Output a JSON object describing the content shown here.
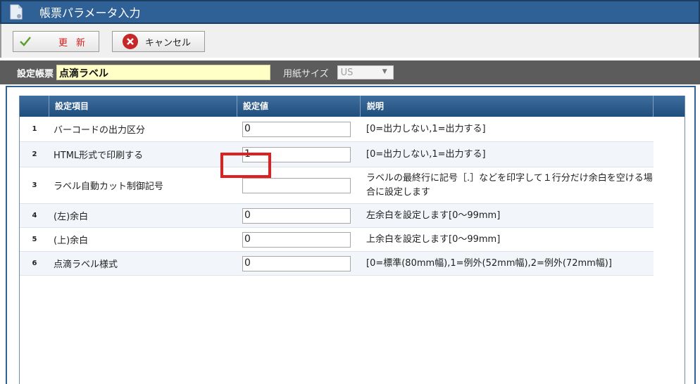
{
  "window": {
    "title": "帳票パラメータ入力"
  },
  "toolbar": {
    "update_label": "更新",
    "cancel_label": "キャンセル"
  },
  "filter": {
    "form_label": "設定帳票",
    "form_value": "点滴ラベル",
    "paper_label": "用紙サイズ",
    "paper_value": "US"
  },
  "table": {
    "headers": {
      "item": "設定項目",
      "value": "設定値",
      "desc": "説明"
    },
    "rows": [
      {
        "num": "1",
        "item": "バーコードの出力区分",
        "value": "0",
        "desc": "[0=出力しない,1=出力する]"
      },
      {
        "num": "2",
        "item": "HTML形式で印刷する",
        "value": "1",
        "desc": "[0=出力しない,1=出力する]"
      },
      {
        "num": "3",
        "item": "ラベル自動カット制御記号",
        "value": "",
        "desc": "ラベルの最終行に記号［.］などを印字して１行分だけ余白を空ける場合に設定します"
      },
      {
        "num": "4",
        "item": "(左)余白",
        "value": "0",
        "desc": "左余白を設定します[0～99mm]"
      },
      {
        "num": "5",
        "item": "(上)余白",
        "value": "0",
        "desc": "上余白を設定します[0～99mm]"
      },
      {
        "num": "6",
        "item": "点滴ラベル様式",
        "value": "0",
        "desc": "[0=標準(80mm幅),1=例外(52mm幅),2=例外(72mm幅)]"
      }
    ]
  },
  "icons": {
    "title": "document-icon",
    "update": "check-icon",
    "cancel": "cancel-icon"
  },
  "colors": {
    "titlebar": "#2f6196",
    "header": "#1f4d7c",
    "highlight": "#e02020",
    "update_text": "#d81b1b",
    "form_value_bg": "#ffffc6"
  }
}
